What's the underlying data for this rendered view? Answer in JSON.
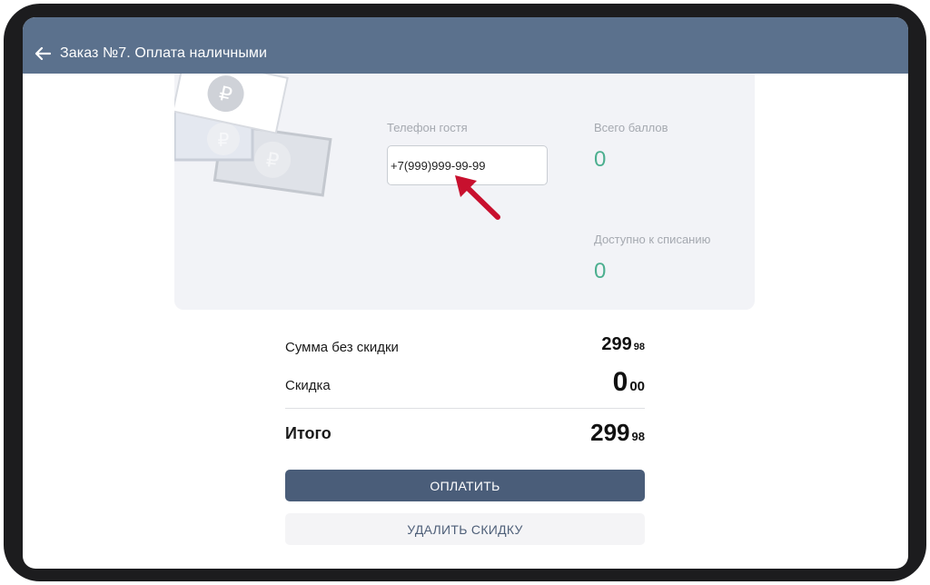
{
  "header": {
    "title": "Заказ №7. Оплата наличными",
    "back_icon": "arrow-left-icon"
  },
  "loyalty": {
    "phone_label": "Телефон гостя",
    "phone_value": "+7(999)999-99-99",
    "total_points_label": "Всего баллов",
    "total_points_value": "0",
    "available_label": "Доступно к списанию",
    "available_value": "0",
    "illustration_icon": "ruble-banknotes-icon",
    "annotation_icon": "red-arrow-annotation-icon"
  },
  "summary": {
    "subtotal_label": "Сумма без скидки",
    "subtotal_int": "299",
    "subtotal_dec": "98",
    "discount_label": "Скидка",
    "discount_int": "0",
    "discount_dec": "00",
    "total_label": "Итого",
    "total_int": "299",
    "total_dec": "98"
  },
  "actions": {
    "pay_label": "ОПЛАТИТЬ",
    "remove_discount_label": "УДАЛИТЬ СКИДКУ"
  },
  "colors": {
    "header_bg": "#5b718d",
    "primary_button": "#4a5d79",
    "points_green": "#4caf8f",
    "annotation_red": "#c8102e"
  }
}
